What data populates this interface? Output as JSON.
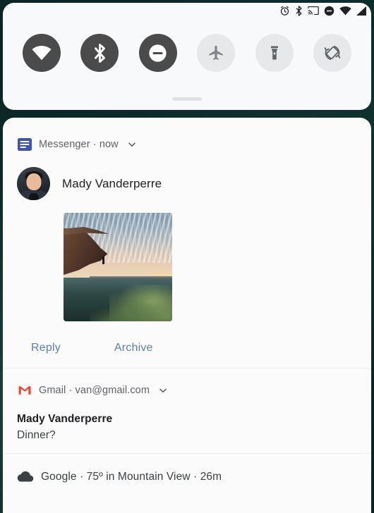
{
  "status_bar": {
    "icons": [
      {
        "name": "alarm-icon",
        "label": "Alarm set"
      },
      {
        "name": "bluetooth-icon",
        "label": "Bluetooth on"
      },
      {
        "name": "cast-icon",
        "label": "Cast"
      },
      {
        "name": "do-not-disturb-icon",
        "label": "Do not disturb"
      },
      {
        "name": "wifi-icon",
        "label": "Wi-Fi"
      },
      {
        "name": "cell-signal-icon",
        "label": "Mobile signal"
      }
    ]
  },
  "quick_settings": {
    "tiles": [
      {
        "name": "wifi-tile",
        "label": "Wi-Fi",
        "icon": "wifi-icon",
        "state": "on"
      },
      {
        "name": "bluetooth-tile",
        "label": "Bluetooth",
        "icon": "bluetooth-icon",
        "state": "on"
      },
      {
        "name": "do-not-disturb-tile",
        "label": "Do Not Disturb",
        "icon": "do-not-disturb-icon",
        "state": "on"
      },
      {
        "name": "airplane-tile",
        "label": "Airplane mode",
        "icon": "airplane-icon",
        "state": "off"
      },
      {
        "name": "flashlight-tile",
        "label": "Flashlight",
        "icon": "flashlight-icon",
        "state": "off"
      },
      {
        "name": "auto-rotate-tile",
        "label": "Auto-rotate",
        "icon": "auto-rotate-icon",
        "state": "off"
      }
    ],
    "handle_label": "Expand quick settings"
  },
  "notifications": [
    {
      "id": "messenger",
      "app_name": "Messenger",
      "separator": "·",
      "time": "now",
      "header_text": "Messenger · now",
      "sender": "Mady Vanderperre",
      "has_image": true,
      "image_alt": "Sunset over valley from a cliff",
      "actions": [
        {
          "name": "reply-action",
          "label": "Reply"
        },
        {
          "name": "archive-action",
          "label": "Archive"
        }
      ]
    },
    {
      "id": "gmail",
      "app_name": "Gmail",
      "account": "van@gmail.com",
      "header_text": "Gmail · van@gmail.com",
      "title": "Mady Vanderperre",
      "body": "Dinner?"
    },
    {
      "id": "google-weather",
      "app_name": "Google",
      "temperature": "75º",
      "location": "Mountain View",
      "time": "26m",
      "header_text": "Google · 75º in Mountain View · 26m"
    }
  ],
  "colors": {
    "panel_background": "#f8f9fa",
    "shade_background": "#fbfbfb",
    "tile_on": "#4b4b4b",
    "tile_off": "#e6e8ea",
    "action_link": "#5b7fb0",
    "messenger_blue": "#3b5998",
    "gmail_red": "#ea4335",
    "wallpaper": "#0d2726",
    "divider": "#eceef0"
  }
}
